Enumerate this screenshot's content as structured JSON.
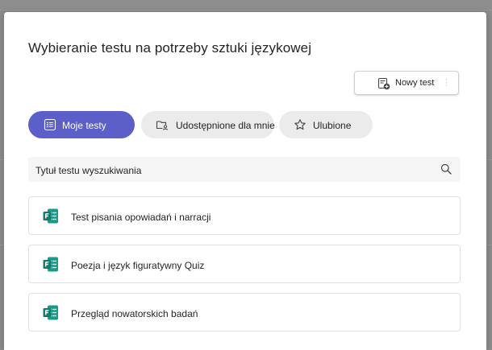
{
  "dialog": {
    "title": "Wybieranie testu na potrzeby sztuki językowej",
    "new_test_button": {
      "label": "Nowy test",
      "icon": "new-form-icon"
    },
    "tabs": [
      {
        "label": "Moje testy",
        "icon": "list-icon",
        "selected": true
      },
      {
        "label": "Udostępnione dla mnie",
        "icon": "shared-folder-icon",
        "selected": false
      },
      {
        "label": "Ulubione",
        "icon": "star-icon",
        "selected": false
      }
    ],
    "search": {
      "text": "Tytuł testu wyszukiwania",
      "icon": "search-icon"
    },
    "items": [
      {
        "label": "Test pisania opowiadań i narracji",
        "icon": "forms-icon"
      },
      {
        "label": "Poezja i język figuratywny Quiz",
        "icon": "forms-icon"
      },
      {
        "label": "Przegląd nowatorskich badań",
        "icon": "forms-icon"
      }
    ]
  },
  "colors": {
    "accent": "#5b5fc7",
    "forms_green": "#0f7b6c",
    "tab_inactive": "#ebebeb",
    "backdrop": "#8e8e8e"
  }
}
